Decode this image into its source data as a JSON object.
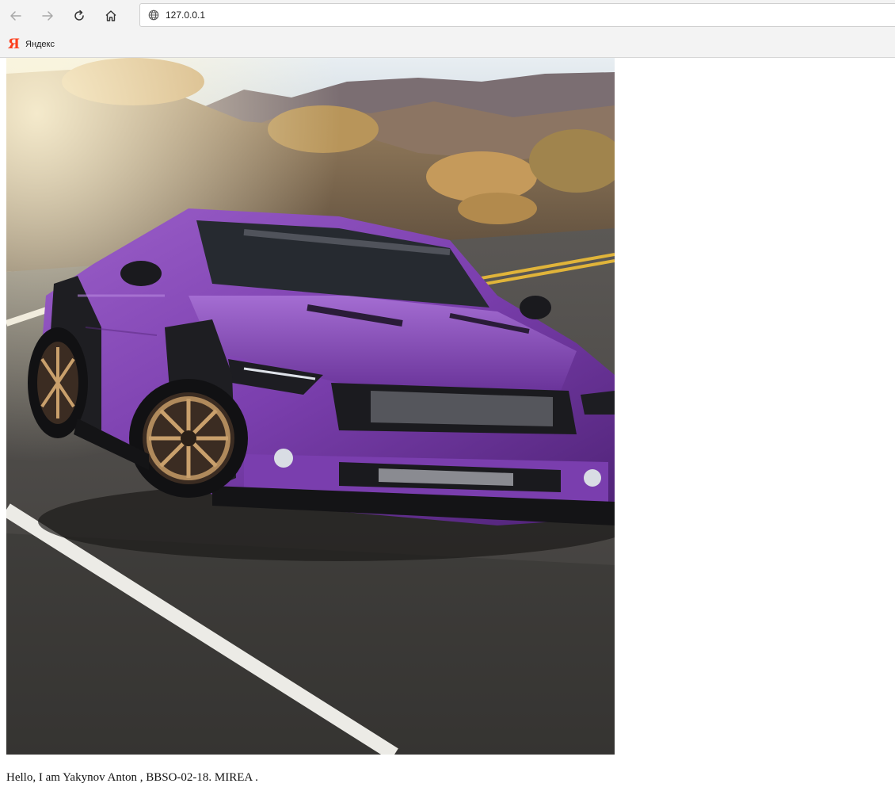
{
  "browser": {
    "url": "127.0.0.1",
    "icons": {
      "back": "arrow-left-icon",
      "forward": "arrow-right-icon",
      "reload": "reload-icon",
      "home": "home-icon",
      "site": "globe-icon"
    },
    "bookmarks": [
      {
        "label": "Яндекс",
        "icon": "yandex-logo-icon",
        "icon_glyph": "Я",
        "icon_color": "#fc3f1d"
      }
    ]
  },
  "page": {
    "image": {
      "subject": "purple-sports-car-photo"
    },
    "caption": "Hello, I am Yakynov Anton , BBSO-02-18. MIREA ."
  }
}
